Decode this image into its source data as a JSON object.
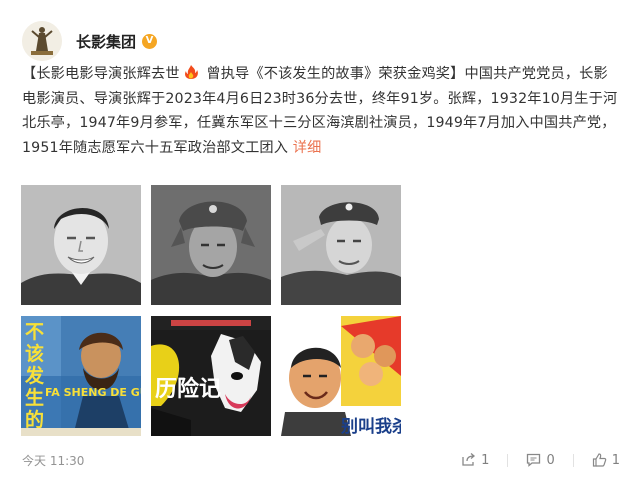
{
  "account": {
    "name": "长影集团",
    "verified_badge": "V",
    "avatar_icon": "changying-logo-icon"
  },
  "post": {
    "text_part1": "【长影电影导演张辉去世",
    "fire_icon": "fire-icon",
    "text_part2": " 曾执导《不该发生的故事》荣获金鸡奖】中国共产党党员，长影电影演员、导演张辉于2023年4月6日23时36分去世，终年91岁。张辉，1932年10月生于河北乐亭，1947年9月参军，任冀东军区十三分区海滨剧社演员，1949年7月加入中国共产党，1951年随志愿军六十五军政治部文工团入 ",
    "more_label": "详细"
  },
  "images": [
    {
      "name": "photo-portrait-smiling",
      "caption": ""
    },
    {
      "name": "photo-soldier-cap",
      "caption": ""
    },
    {
      "name": "photo-soldier-salute",
      "caption": ""
    },
    {
      "name": "poster-bugai-fasheng-de-gushi",
      "title": "不该发生的故事",
      "subtitle": "FA SHENG DE GU"
    },
    {
      "name": "poster-dog-film",
      "title": "历险记"
    },
    {
      "name": "poster-comedy-film",
      "title": "别叫我杀"
    }
  ],
  "footer": {
    "time": "今天 11:30",
    "share_count": "1",
    "comment_count": "0",
    "like_count": "1",
    "share_icon": "share-icon",
    "comment_icon": "comment-icon",
    "like_icon": "thumbs-up-icon"
  },
  "colors": {
    "link": "#eb7350",
    "badge": "#f5a623",
    "meta": "#939393"
  }
}
